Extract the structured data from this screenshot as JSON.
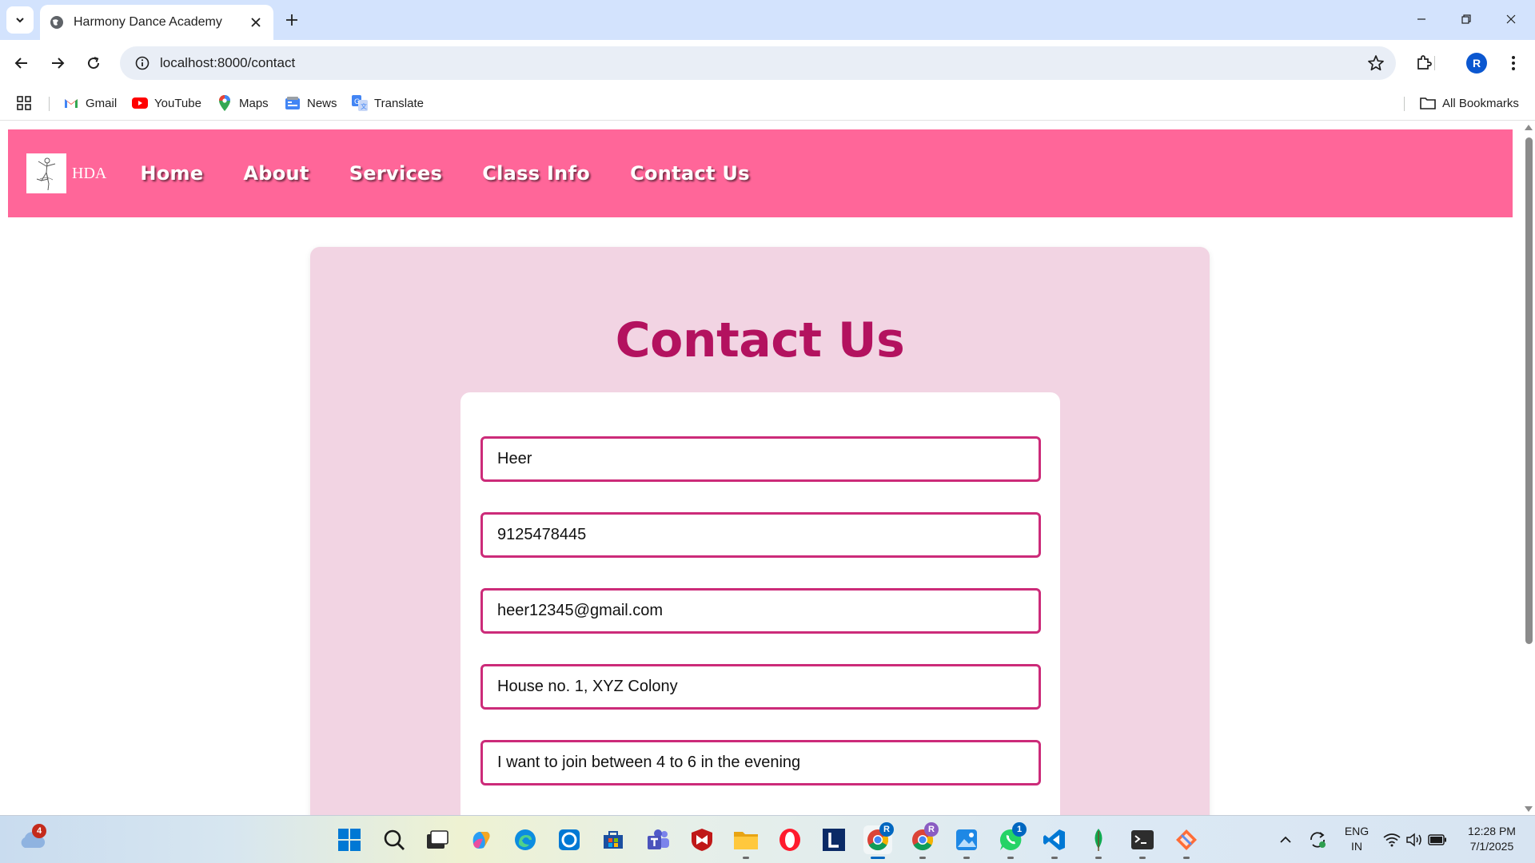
{
  "browser": {
    "tab_title": "Harmony Dance Academy",
    "url": "localhost:8000/contact",
    "profile_initial": "R",
    "bookmarks": [
      {
        "label": "Gmail",
        "icon": "gmail-icon"
      },
      {
        "label": "YouTube",
        "icon": "youtube-icon"
      },
      {
        "label": "Maps",
        "icon": "maps-icon"
      },
      {
        "label": "News",
        "icon": "news-icon"
      },
      {
        "label": "Translate",
        "icon": "translate-icon"
      }
    ],
    "all_bookmarks_label": "All Bookmarks"
  },
  "site": {
    "logo_text": "HDA",
    "nav": [
      "Home",
      "About",
      "Services",
      "Class Info",
      "Contact Us"
    ],
    "colors": {
      "nav_bg": "#ff6699",
      "title": "#b3125f",
      "card_bg": "#f2d4e3",
      "field_border": "#cc2b79"
    }
  },
  "contact": {
    "title": "Contact Us",
    "fields": {
      "name": "Heer",
      "phone": "9125478445",
      "email": "heer12345@gmail.com",
      "address": "House no. 1, XYZ Colony",
      "message": "I want to join between 4 to 6 in the evening"
    }
  },
  "taskbar": {
    "weather_badge": "4",
    "whatsapp_badge": "1",
    "language": "ENG",
    "region": "IN",
    "time": "12:28 PM",
    "date": "7/1/2025"
  }
}
